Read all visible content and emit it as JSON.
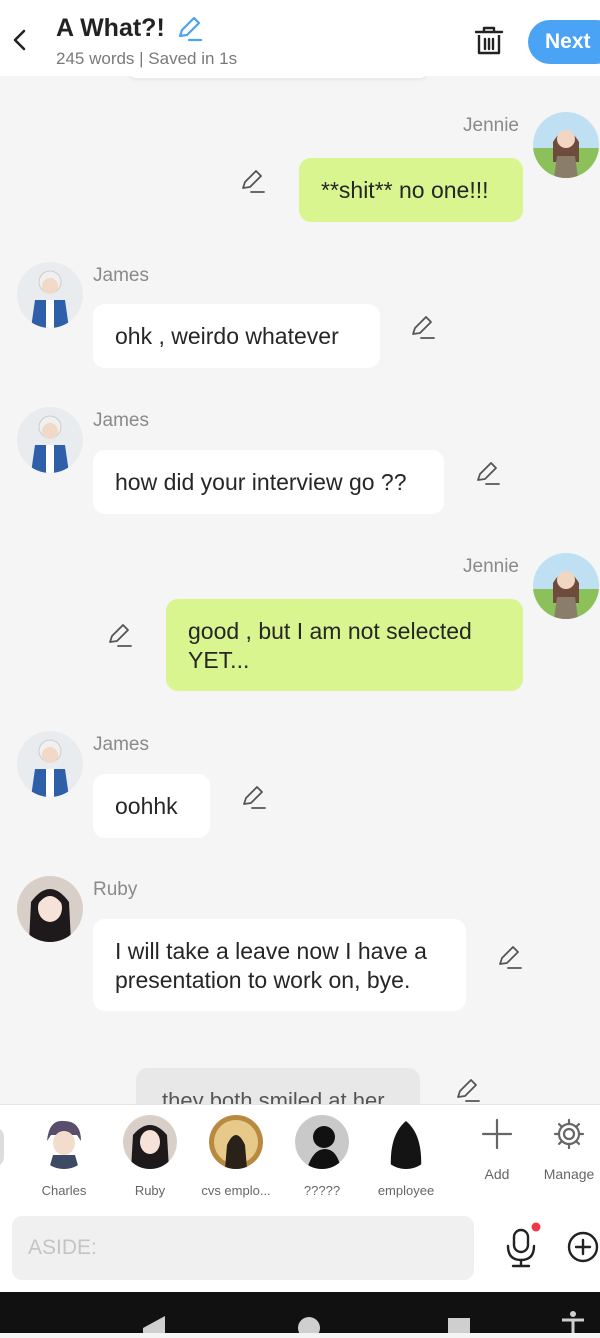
{
  "header": {
    "title": "A What?!",
    "subtitle": "245 words | Saved in 1s",
    "next_label": "Next"
  },
  "messages": [
    {
      "name": "Jennie",
      "text": "**shit** no one!!!",
      "side": "right"
    },
    {
      "name": "James",
      "text": "ohk , weirdo whatever",
      "side": "left"
    },
    {
      "name": "James",
      "text": "how did your interview go ??",
      "side": "left"
    },
    {
      "name": "Jennie",
      "text": "good , but I am not selected YET...",
      "side": "right"
    },
    {
      "name": "James",
      "text": "oohhk",
      "side": "left"
    },
    {
      "name": "Ruby",
      "text": "I will take a leave now I have a presentation to work on, bye.",
      "side": "left"
    }
  ],
  "narration": {
    "text": "they both smiled at her"
  },
  "characters": [
    {
      "label": "Charles"
    },
    {
      "label": "Ruby"
    },
    {
      "label": "cvs emplo..."
    },
    {
      "label": "?????"
    },
    {
      "label": "employee"
    }
  ],
  "tools": {
    "add_label": "Add",
    "manage_label": "Manage"
  },
  "input": {
    "placeholder": "ASIDE:"
  },
  "colors": {
    "accent": "#4ba3f5",
    "right_bubble": "#d8f58f",
    "left_bubble": "#ffffff",
    "background": "#f5f5f5"
  }
}
